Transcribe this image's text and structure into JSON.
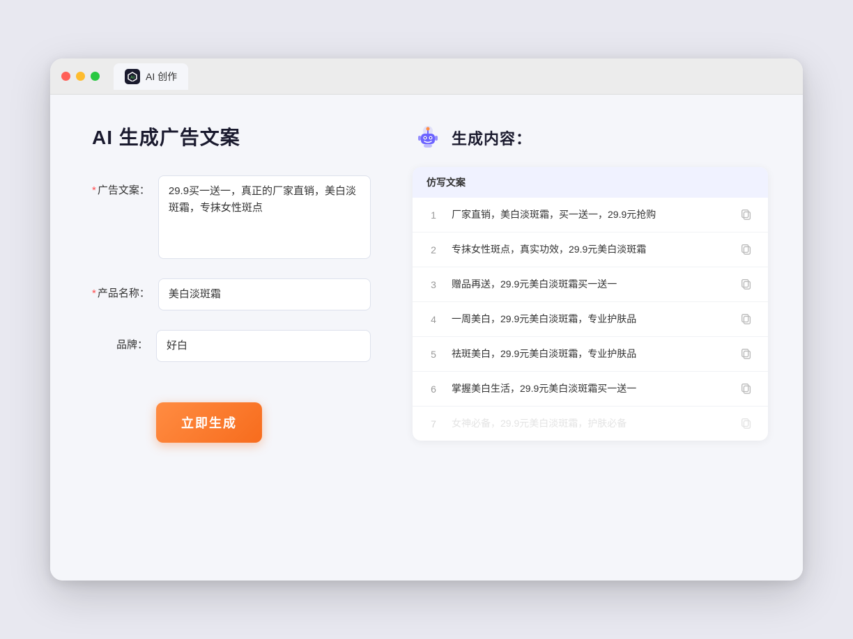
{
  "browser": {
    "tab_label": "AI 创作",
    "tab_icon_text": "AI"
  },
  "left": {
    "page_title": "AI 生成广告文案",
    "form": {
      "ad_copy_label": "广告文案：",
      "ad_copy_required": "*",
      "ad_copy_value": "29.9买一送一，真正的厂家直销，美白淡斑霜，专抹女性斑点",
      "product_label": "产品名称：",
      "product_required": "*",
      "product_value": "美白淡斑霜",
      "brand_label": "品牌：",
      "brand_value": "好白",
      "generate_btn_label": "立即生成"
    }
  },
  "right": {
    "result_title": "生成内容：",
    "table_header": "仿写文案",
    "rows": [
      {
        "num": "1",
        "text": "厂家直销，美白淡斑霜，买一送一，29.9元抢购"
      },
      {
        "num": "2",
        "text": "专抹女性斑点，真实功效，29.9元美白淡斑霜"
      },
      {
        "num": "3",
        "text": "赠品再送，29.9元美白淡斑霜买一送一"
      },
      {
        "num": "4",
        "text": "一周美白，29.9元美白淡斑霜，专业护肤品"
      },
      {
        "num": "5",
        "text": "祛斑美白，29.9元美白淡斑霜，专业护肤品"
      },
      {
        "num": "6",
        "text": "掌握美白生活，29.9元美白淡斑霜买一送一"
      },
      {
        "num": "7",
        "text": "女神必备，29.9元美白淡斑霜，护肤必备"
      }
    ]
  }
}
